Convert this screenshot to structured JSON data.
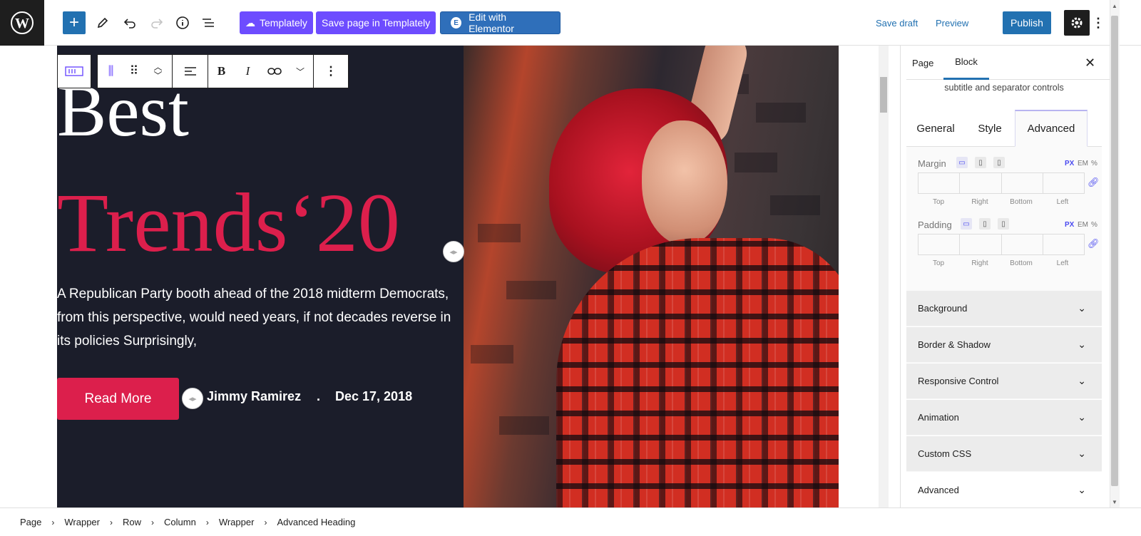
{
  "topbar": {
    "add_block_icon": "plus-icon",
    "templately_label": "Templately",
    "save_templately_label": "Save page in Templately",
    "elementor_label": "Edit with Elementor",
    "save_draft_label": "Save draft",
    "preview_label": "Preview",
    "publish_label": "Publish",
    "colors": {
      "brand": "#2271b1",
      "templately": "#6d4cff",
      "elementor": "#2f6fba"
    }
  },
  "block_toolbar": {
    "icons": [
      "block-type-icon",
      "drag-handle-icon",
      "move-up-down-icon",
      "align-icon",
      "bold-icon",
      "italic-icon",
      "link-icon",
      "more-rich-text-icon",
      "options-icon"
    ]
  },
  "hero": {
    "line1": "Best",
    "line2": "Trends",
    "line2_quote": "‘20",
    "description": "A Republican Party booth ahead of the 2018 midterm Democrats, from this perspective, would need years, if not decades reverse in its policies Surprisingly,",
    "button_label": "Read More",
    "author": "Jimmy Ramirez",
    "separator": ".",
    "date": "Dec 17, 2018",
    "colors": {
      "background": "#1b1d2a",
      "accent": "#dc1f4c"
    }
  },
  "sidebar": {
    "tabs": [
      "Page",
      "Block"
    ],
    "active_tab": "Block",
    "description_tail": "subtitle and separator controls",
    "sub_tabs": [
      "General",
      "Style",
      "Advanced"
    ],
    "active_sub_tab": "Advanced",
    "margin": {
      "label": "Margin",
      "units": [
        "PX",
        "EM",
        "%"
      ],
      "sides": [
        "Top",
        "Right",
        "Bottom",
        "Left"
      ]
    },
    "padding": {
      "label": "Padding",
      "units": [
        "PX",
        "EM",
        "%"
      ],
      "sides": [
        "Top",
        "Right",
        "Bottom",
        "Left"
      ]
    },
    "sections": [
      "Background",
      "Border & Shadow",
      "Responsive Control",
      "Animation",
      "Custom CSS",
      "Advanced"
    ]
  },
  "breadcrumbs": [
    "Page",
    "Wrapper",
    "Row",
    "Column",
    "Wrapper",
    "Advanced Heading"
  ]
}
